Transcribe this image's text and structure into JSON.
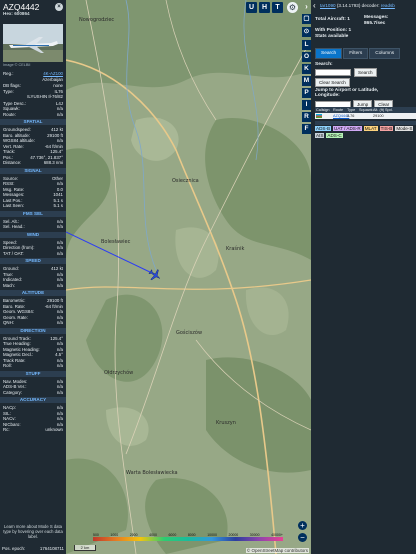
{
  "map": {
    "labels": [
      "Nowogrodziec",
      "Osiecznica",
      "Bolesławiec",
      "Kraśnik",
      "Gościszów",
      "Ołdrzychów",
      "Kruszyn",
      "Warta Bolesławiecka",
      "Nowogrodziec"
    ],
    "top_buttons": [
      "U",
      "H",
      "T"
    ],
    "side_buttons": [
      "L",
      "O",
      "K",
      "M",
      "P",
      "I",
      "R",
      "F"
    ],
    "attribution": "© OpenStreetMap contributors",
    "scale": "2 km",
    "altitude_legend": [
      "500",
      "1000",
      "2000",
      "4000",
      "6000",
      "8000",
      "10000",
      "20000",
      "30000",
      "40000+"
    ],
    "zoom_in": "+",
    "zoom_out": "−",
    "colors": {
      "aircraft": "#2a4bd7",
      "track": "#2b3bf5"
    }
  },
  "left": {
    "callsign": "AZQ4442",
    "hex_label": "Hex:",
    "hex": "600864",
    "close": "×",
    "photo_credit": "Image © CELBII",
    "rows_top": [
      [
        "Reg.:",
        "4K-AZ100"
      ],
      [
        "",
        "Azerbaijan"
      ],
      [
        "DB flags:",
        "none"
      ],
      [
        "Type:",
        "IL76"
      ],
      [
        "",
        "ILYUSHIN Il-76/82"
      ],
      [
        "Type Desc.:",
        "L4J"
      ],
      [
        "Squawk:",
        "n/a"
      ],
      [
        "Route:",
        "n/a"
      ]
    ],
    "spatial_title": "SPATIAL",
    "spatial": [
      [
        "Groundspeed:",
        "412 kt"
      ],
      [
        "Baro. altitude:",
        "29100 ft"
      ],
      [
        "WGS84 altitude:",
        "n/a"
      ],
      [
        "Vert. Rate:",
        "-64 ft/min"
      ],
      [
        "Track:",
        "125.4°"
      ],
      [
        "Pos.:",
        "47.736°, 21.837°"
      ],
      [
        "Distance:",
        "688.3 nmi"
      ]
    ],
    "signal_title": "SIGNAL",
    "signal": [
      [
        "Source:",
        "Other"
      ],
      [
        "RSSI:",
        "n/a"
      ],
      [
        "Msg. Rate:",
        "0.0"
      ],
      [
        "Messages:",
        "1041"
      ],
      [
        "Last Pos.:",
        "5.1 s"
      ],
      [
        "Last Seen:",
        "5.1 s"
      ]
    ],
    "fms_title": "FMS SEL",
    "fms": [
      [
        "Sel. Alt.:",
        "n/a"
      ],
      [
        "Sel. Head.:",
        "n/a"
      ]
    ],
    "wind_title": "WIND",
    "wind": [
      [
        "Speed:",
        "n/a"
      ],
      [
        "Direction (from):",
        "n/a"
      ],
      [
        "TAT / OAT:",
        "n/a"
      ]
    ],
    "speed_title": "SPEED",
    "speed": [
      [
        "Ground:",
        "412 kt"
      ],
      [
        "True:",
        "n/a"
      ],
      [
        "Indicated:",
        "n/a"
      ],
      [
        "Mach:",
        "n/a"
      ]
    ],
    "altitude_title": "ALTITUDE",
    "altitude": [
      [
        "Barometric:",
        "29100 ft"
      ],
      [
        "Baro. Rate:",
        "-64 ft/min"
      ],
      [
        "Geom. WGS84:",
        "n/a"
      ],
      [
        "Geom. Rate:",
        "n/a"
      ],
      [
        "QNH:",
        "n/a"
      ]
    ],
    "direction_title": "DIRECTION",
    "direction": [
      [
        "Ground Track:",
        "125.4°"
      ],
      [
        "True Heading:",
        "n/a"
      ],
      [
        "Magnetic Heading:",
        "n/a"
      ],
      [
        "Magnetic Decl.:",
        "4.5°"
      ],
      [
        "Track Rate:",
        "n/a"
      ],
      [
        "Roll:",
        "n/a"
      ]
    ],
    "stuff_title": "STUFF",
    "stuff": [
      [
        "Nav. Modes:",
        "n/a"
      ],
      [
        "ADS-B Ver.:",
        "n/a"
      ],
      [
        "Category:",
        "n/a"
      ]
    ],
    "accuracy_title": "ACCURACY",
    "accuracy": [
      [
        "NACp:",
        "n/a"
      ],
      [
        "SIL:",
        "n/a"
      ],
      [
        "NACv:",
        "n/a"
      ],
      [
        "NICbaro:",
        "n/a"
      ],
      [
        "Rc:",
        "unknown"
      ]
    ],
    "learn_more": "Learn more about Mode S data type by hovering over each data label.",
    "epoch_label": "Pos. epoch:",
    "epoch_value": "1764108711"
  },
  "right": {
    "collapse": "‹",
    "version_link": "tar1090",
    "version_text": "(3.14.1793) decoder:",
    "version_tail": "readsb",
    "total_label": "Total Aircraft:",
    "total_value": "1",
    "messages_label": "Messages:",
    "messages_value": "865.7/sec",
    "with_pos_label": "With Position:",
    "with_pos_value": "1",
    "stats_text": "Stats available",
    "tabs": [
      "Search",
      "Filters",
      "Columns"
    ],
    "search_label": "Search:",
    "search_button": "Search",
    "clear_search": "Clear Search",
    "jump_label": "Jump to Airport or Latitude, Longitude:",
    "jump_button": "Jump",
    "clear_button": "Clear",
    "table_headers": [
      "Callsign",
      "Route",
      "Type",
      "Squawk",
      "Alt. (ft)",
      "Spd.",
      "Hdg."
    ],
    "table_rows": [
      [
        "",
        "AZQ4442",
        "IL76",
        "",
        "29100",
        "",
        ""
      ]
    ],
    "legend": [
      {
        "label": "ADS-B",
        "color": "#8fd3fe"
      },
      {
        "label": "UAT / ADS-R",
        "color": "#d0a9f5"
      },
      {
        "label": "MLAT",
        "color": "#fbd27d"
      },
      {
        "label": "TIS-B",
        "color": "#f5a3a3"
      },
      {
        "label": "Mode-S",
        "color": "#e0e0e0"
      },
      {
        "label": "AIS",
        "color": "#c6d0d8"
      },
      {
        "label": "ADS-C",
        "color": "#b4f1b4"
      }
    ]
  }
}
